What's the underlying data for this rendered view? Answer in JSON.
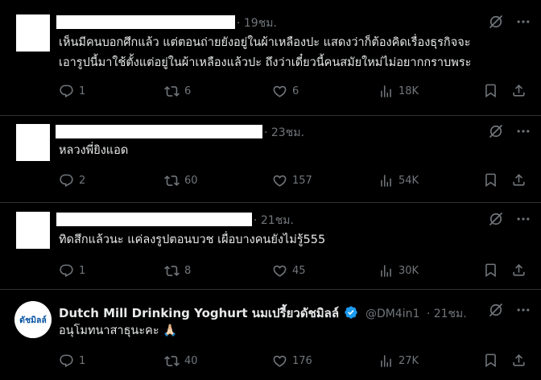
{
  "colors": {
    "background": "#000000",
    "text": "#e7e9ea",
    "muted": "#71767b",
    "divider": "#2f3336",
    "verified": "#1d9bf0",
    "brand_blue": "#0b57a4"
  },
  "replies": [
    {
      "time": "· 19ชม.",
      "lines": [
        "เห็นมีคนบอกศึกแล้ว  แต่ตอนถ่ายยังอยู่ในผ้าเหลืองปะ  แสดงว่าก็ต้องคิดเรื่องธุรกิจจะ",
        "เอารูปนี้มาใช้ตั้งแต่อยู่ในผ้าเหลืองแล้วปะ  ถึงว่าเดี๋ยวนี้คนสมัยใหม่ไม่อยากกราบพระ"
      ],
      "replies": "1",
      "reposts": "6",
      "likes": "6",
      "views": "18K"
    },
    {
      "time": "· 23ชม.",
      "lines": [
        "หลวงพี่ยิงแอด"
      ],
      "replies": "2",
      "reposts": "60",
      "likes": "157",
      "views": "54K"
    },
    {
      "time": "· 21ชม.",
      "lines": [
        "ทิดสึกแล้วนะ แค่ลงรูปตอนบวช เผื่อบางคนยังไม่รู้555"
      ],
      "replies": "1",
      "reposts": "8",
      "likes": "45",
      "views": "30K"
    },
    {
      "display_name": "Dutch Mill Drinking Yoghurt นมเปรี้ยวดัชมิลล์",
      "handle": "@DM4in1",
      "time": "· 21ชม.",
      "avatar_text": "ดัชมิลล์",
      "lines": [
        "อนุโมทนาสาธุนะคะ 🙏🏻"
      ],
      "replies": "1",
      "reposts": "40",
      "likes": "176",
      "views": "27K"
    }
  ],
  "icons": {
    "reply": "reply-icon",
    "repost": "repost-icon",
    "like": "heart-icon",
    "views": "views-icon",
    "bookmark": "bookmark-icon",
    "share": "share-icon",
    "grok": "grok-icon",
    "more": "more-icon",
    "verified": "verified-badge-icon"
  }
}
